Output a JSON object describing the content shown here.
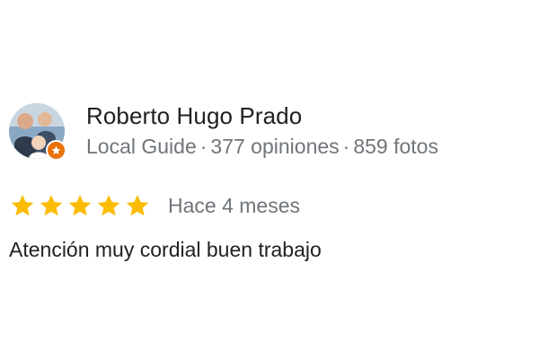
{
  "review": {
    "author": {
      "name": "Roberto Hugo Prado",
      "badge": "Local Guide",
      "separator": "·",
      "reviews_count": "377 opiniones",
      "photos_count": "859 fotos",
      "avatar_icon": "avatar-photo",
      "badge_icon": "local-guide-star-icon"
    },
    "rating": {
      "stars": 5,
      "max_stars": 5,
      "star_color": "#fbbc04",
      "date": "Hace 4 meses"
    },
    "text": "Atención muy cordial buen trabajo"
  },
  "colors": {
    "primary_text": "#202124",
    "secondary_text": "#70757a",
    "badge_orange": "#e8710a"
  }
}
